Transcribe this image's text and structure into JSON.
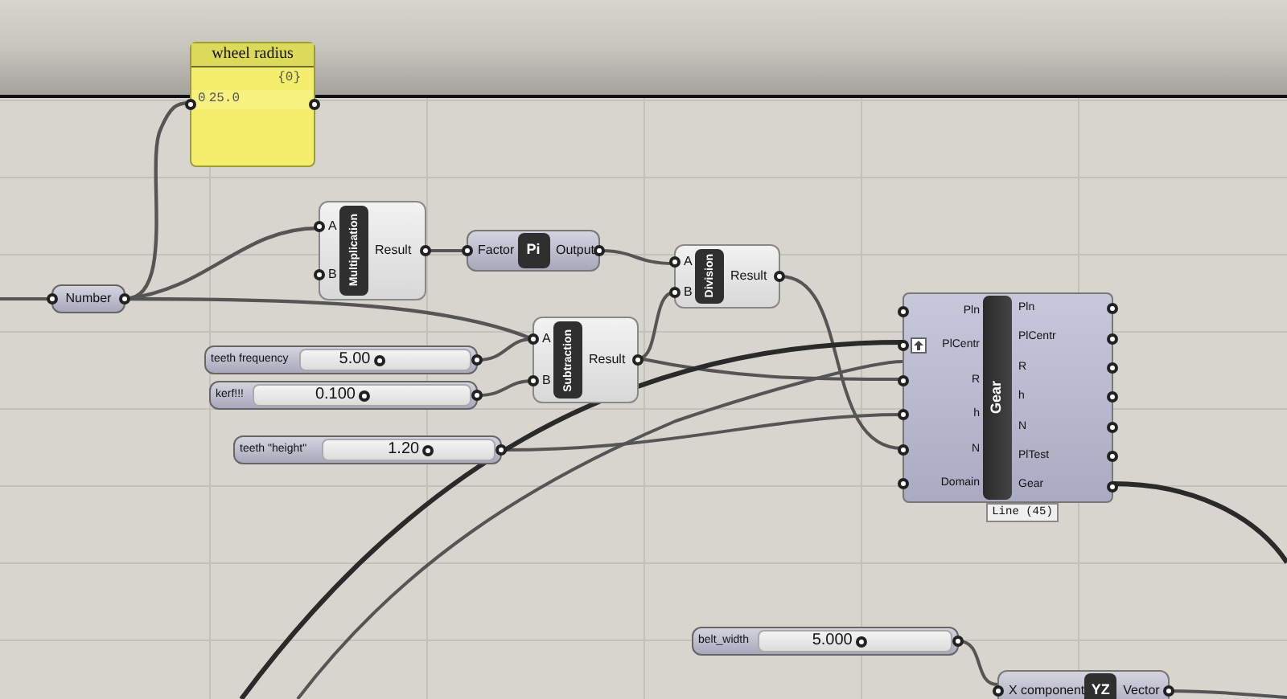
{
  "nodes": [
    {
      "kind": "panel",
      "title": "wheel radius",
      "path": "{0}",
      "index": "0",
      "value": "25.0"
    },
    {
      "kind": "param",
      "name": "Number"
    },
    {
      "kind": "component",
      "name": "Multiplication",
      "inputs": [
        "A",
        "B"
      ],
      "outputs": [
        "Result"
      ]
    },
    {
      "kind": "compact",
      "name": "Pi",
      "inputs": [
        "Factor"
      ],
      "outputs": [
        "Output"
      ]
    },
    {
      "kind": "component",
      "name": "Division",
      "inputs": [
        "A",
        "B"
      ],
      "outputs": [
        "Result"
      ]
    },
    {
      "kind": "component",
      "name": "Subtraction",
      "inputs": [
        "A",
        "B"
      ],
      "outputs": [
        "Result"
      ]
    },
    {
      "kind": "slider",
      "name": "teeth frequency",
      "value": "5.00",
      "level": 0.45
    },
    {
      "kind": "slider",
      "name": "kerf!!!",
      "value": "0.100",
      "level": 0.5
    },
    {
      "kind": "slider",
      "name": "teeth \"height\"",
      "value": "1.20",
      "level": 0.6
    },
    {
      "kind": "gear",
      "name": "Gear",
      "inputs": [
        {
          "label": "Pln",
          "pinned": false
        },
        {
          "label": "PlCentr",
          "pinned": true
        },
        {
          "label": "R",
          "pinned": false
        },
        {
          "label": "h",
          "pinned": false
        },
        {
          "label": "N",
          "pinned": false
        },
        {
          "label": "Domain",
          "pinned": false
        }
      ],
      "outputs": [
        "Pln",
        "PlCentr",
        "R",
        "h",
        "N",
        "PlTest",
        "Gear"
      ],
      "footer": "Line (45)"
    },
    {
      "kind": "slider",
      "name": "belt_width",
      "value": "5.000",
      "level": 0.52
    },
    {
      "kind": "compact",
      "name": "YZ",
      "inputs": [
        "X component"
      ],
      "outputs": [
        "Vector"
      ]
    }
  ]
}
